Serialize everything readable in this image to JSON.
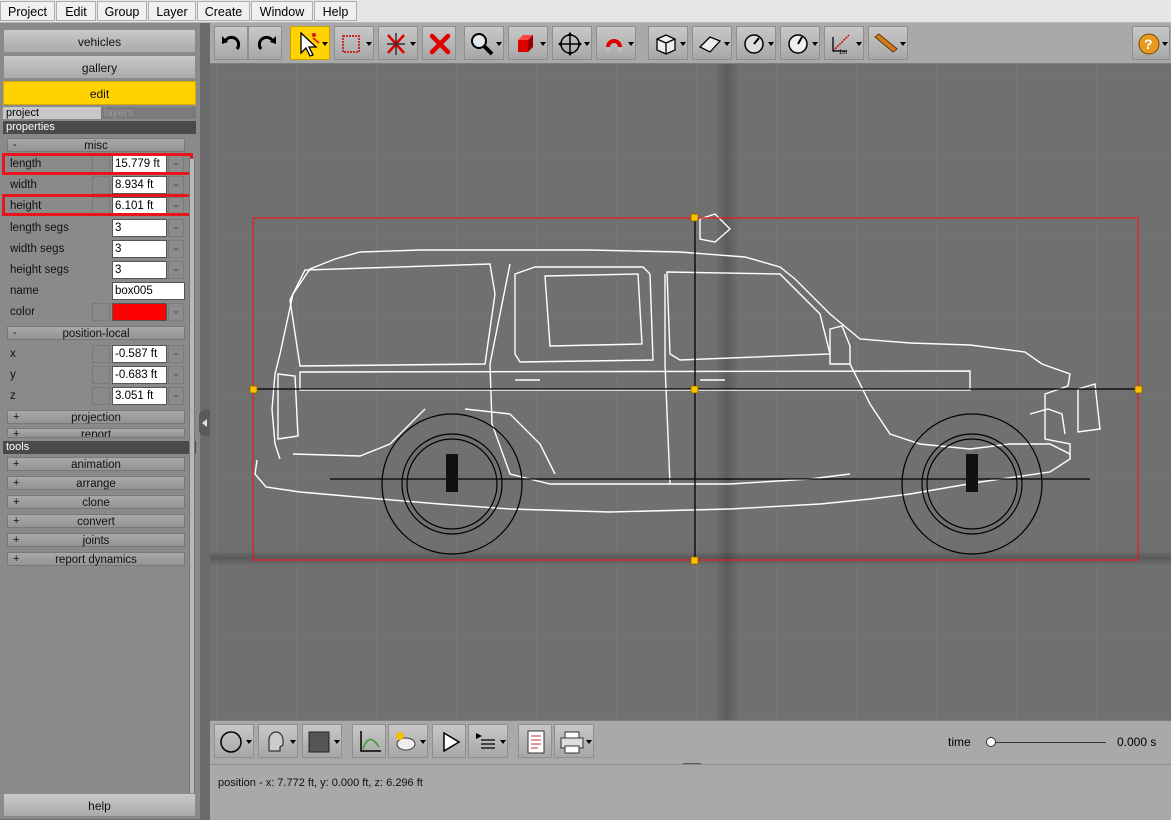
{
  "menu": [
    "Project",
    "Edit",
    "Group",
    "Layer",
    "Create",
    "Window",
    "Help"
  ],
  "nav": {
    "vehicles": "vehicles",
    "gallery": "gallery",
    "edit": "edit",
    "help": "help"
  },
  "tabs": {
    "project": "project",
    "layers": "layers"
  },
  "sections": {
    "properties": "properties",
    "tools": "tools"
  },
  "groups": {
    "misc": "misc",
    "position_local": "position-local",
    "projection": "projection",
    "report": "report"
  },
  "props": [
    {
      "label": "length",
      "value": "15.779 ft"
    },
    {
      "label": "width",
      "value": "8.934 ft"
    },
    {
      "label": "height",
      "value": "6.101 ft"
    },
    {
      "label": "length segs",
      "value": "3"
    },
    {
      "label": "width segs",
      "value": "3"
    },
    {
      "label": "height segs",
      "value": "3"
    },
    {
      "label": "name",
      "value": "box005"
    },
    {
      "label": "color",
      "value": "#ff0000"
    }
  ],
  "position": [
    {
      "label": "x",
      "value": "-0.587 ft"
    },
    {
      "label": "y",
      "value": "-0.683 ft"
    },
    {
      "label": "z",
      "value": "3.051 ft"
    }
  ],
  "tools": [
    "animation",
    "arrange",
    "clone",
    "convert",
    "joints",
    "report dynamics"
  ],
  "time": {
    "label": "time",
    "value": "0.000 s",
    "progress": 0
  },
  "status": "position - x: 7.772 ft, y: 0.000 ft, z: 6.296 ft",
  "icons": {
    "toolbar": [
      "undo-icon",
      "redo-icon",
      "select-arrow-icon",
      "selection-box-icon",
      "transform-off-icon",
      "delete-icon",
      "zoom-icon",
      "box-icon",
      "move-icon",
      "magnet-icon",
      "camera-view-icon",
      "camera-orbit-icon",
      "compass-icon",
      "rotate-icon",
      "measure-icon",
      "pencil-icon",
      "help-icon"
    ],
    "bottom": [
      "circle-icon",
      "head-icon",
      "square-icon",
      "graph-icon",
      "render-icon",
      "play-icon",
      "playlist-icon",
      "document-icon",
      "print-icon"
    ]
  },
  "colors": {
    "accent": "#ffd200",
    "highlight": "#e8141b",
    "selection_box": "#e02020"
  }
}
